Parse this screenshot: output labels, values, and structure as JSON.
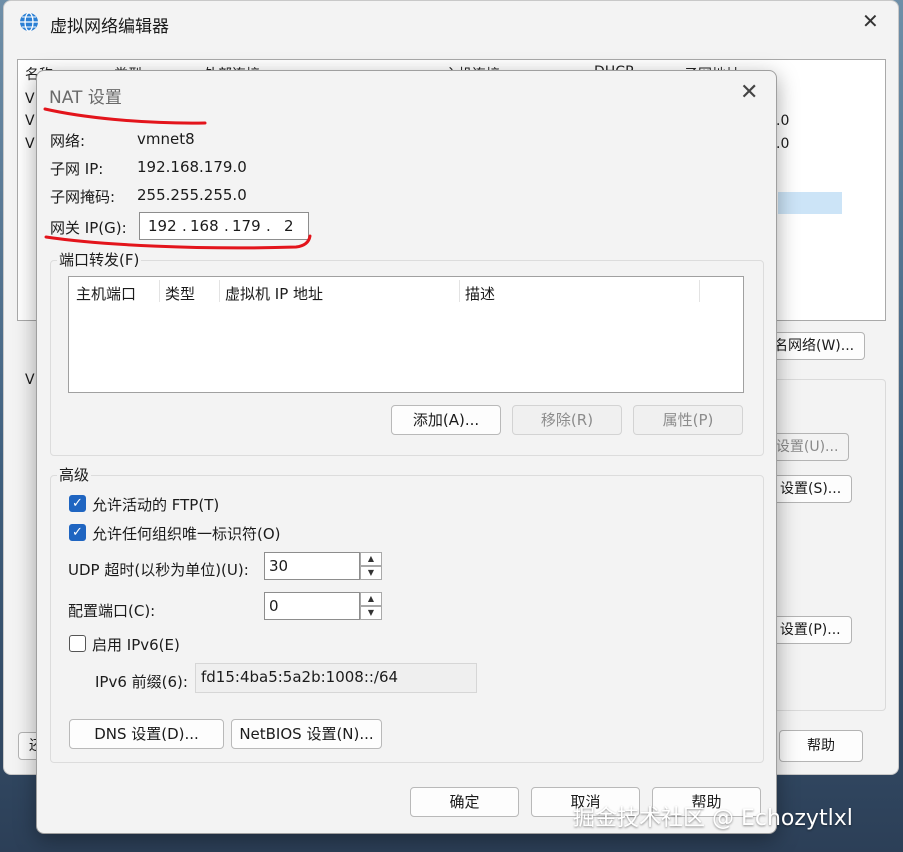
{
  "background_window": {
    "title": "虚拟网络编辑器",
    "columns": [
      "名称",
      "类型",
      "外部连接",
      "主机连接",
      "DHCP",
      "子网地址"
    ],
    "rows": [
      {
        "name": "VI",
        "subnet": ""
      },
      {
        "name": "VI",
        "subnet": ".0"
      },
      {
        "name": "VI",
        "subnet": ".0"
      }
    ],
    "rename_button": "命名网络(W)...",
    "section_label": "VI",
    "dhcp_button": "b设置(U)...",
    "nat_button": "T 设置(S)...",
    "dhcp2_button": "P 设置(P)...",
    "restore_button": "还",
    "help_button": "帮助"
  },
  "dialog": {
    "title": "NAT 设置",
    "network_label": "网络:",
    "network_value": "vmnet8",
    "subnet_ip_label": "子网 IP:",
    "subnet_ip_value": "192.168.179.0",
    "subnet_mask_label": "子网掩码:",
    "subnet_mask_value": "255.255.255.0",
    "gateway_label": "网关 IP(G):",
    "gateway_octets": [
      "192",
      "168",
      "179",
      "2"
    ],
    "port_forwarding": {
      "title": "端口转发(F)",
      "columns": [
        "主机端口",
        "类型",
        "虚拟机 IP 地址",
        "描述"
      ],
      "add_button": "添加(A)...",
      "remove_button": "移除(R)",
      "properties_button": "属性(P)"
    },
    "advanced": {
      "title": "高级",
      "allow_ftp_label": "允许活动的 FTP(T)",
      "allow_ftp_checked": true,
      "allow_oui_label": "允许任何组织唯一标识符(O)",
      "allow_oui_checked": true,
      "udp_timeout_label": "UDP 超时(以秒为单位)(U):",
      "udp_timeout_value": "30",
      "config_port_label": "配置端口(C):",
      "config_port_value": "0",
      "ipv6_label": "启用 IPv6(E)",
      "ipv6_checked": false,
      "ipv6_prefix_label": "IPv6 前缀(6):",
      "ipv6_prefix_value": "fd15:4ba5:5a2b:1008::/64",
      "dns_button": "DNS 设置(D)...",
      "netbios_button": "NetBIOS 设置(N)..."
    },
    "ok_button": "确定",
    "cancel_button": "取消",
    "help_button": "帮助"
  },
  "watermark": "掘金技术社区 @ Echozytlxl",
  "annotation_color": "#e3141b"
}
